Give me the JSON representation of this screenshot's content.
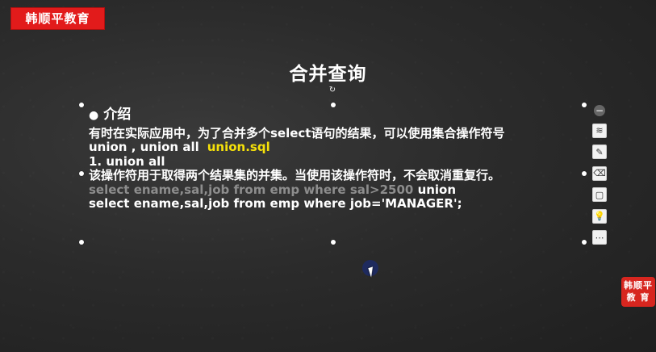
{
  "brand": "韩顺平教育",
  "slide": {
    "title": "合并查询",
    "heading": "介绍",
    "bullet_glyph": "●",
    "lines": [
      "有时在实际应用中，为了合并多个select语句的结果，可以使用集合操作符号",
      "union , union all",
      "1. union all",
      "该操作符用于取得两个结果集的并集。当使用该操作符时，不会取消重复行。",
      "select ename,sal,job from emp where sal>2500",
      "union",
      "select ename,sal,job from emp where job='MANAGER';"
    ],
    "file_label": "union.sql",
    "rotate_glyph": "↻"
  },
  "toolbar": {
    "items": [
      {
        "icon": "minus-icon",
        "glyph": "−"
      },
      {
        "icon": "layers-icon",
        "glyph": "≋"
      },
      {
        "icon": "pen-icon",
        "glyph": "✎"
      },
      {
        "icon": "eraser-icon",
        "glyph": "⌫"
      },
      {
        "icon": "frame-icon",
        "glyph": "▢"
      },
      {
        "icon": "lightbulb-icon",
        "glyph": "💡"
      },
      {
        "icon": "more-icon",
        "glyph": "⋯"
      }
    ]
  },
  "watermark": {
    "line1": "韩顺平",
    "line2": "教 育"
  },
  "colors": {
    "brand_red": "#e21b1b",
    "highlight_yellow": "#f6e10a",
    "dimmed_text": "#8d8d8d"
  }
}
